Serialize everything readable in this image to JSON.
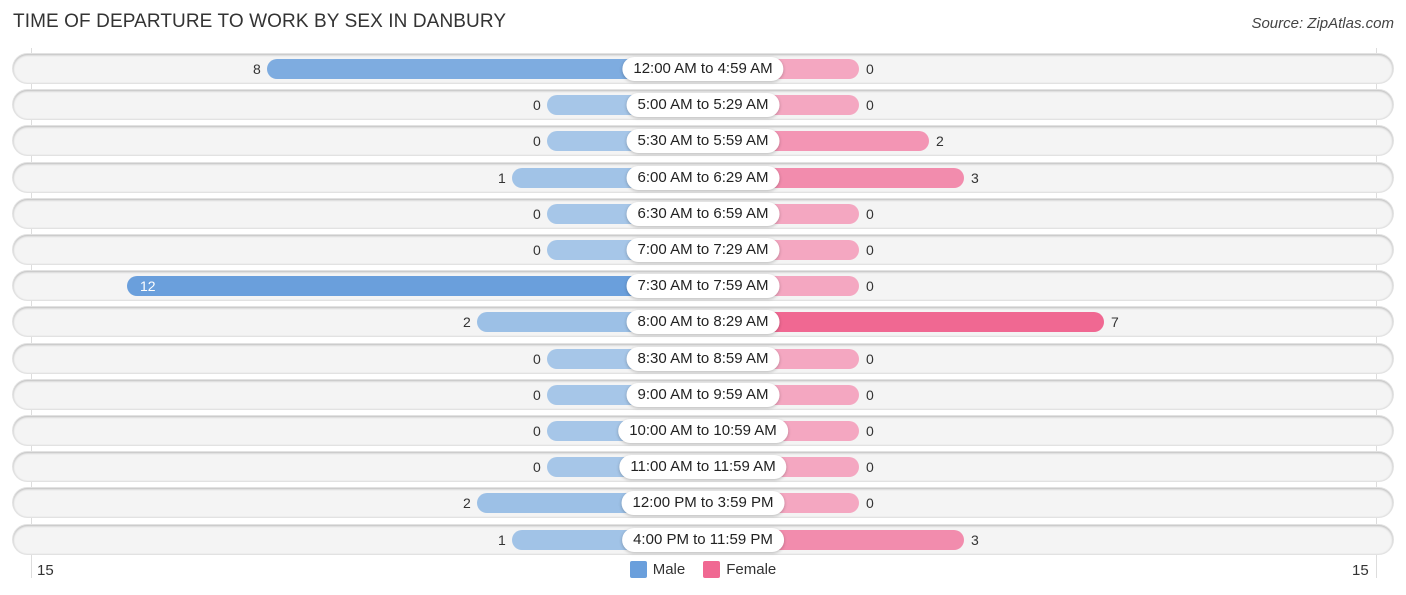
{
  "title": "TIME OF DEPARTURE TO WORK BY SEX IN DANBURY",
  "source": "Source: ZipAtlas.com",
  "colors": {
    "male": "#a6c6e8",
    "male_strong": "#6a9fdc",
    "female": "#f4a7c1",
    "female_strong": "#f06892"
  },
  "chart_data": {
    "type": "bar",
    "orientation": "horizontal-diverging",
    "title": "TIME OF DEPARTURE TO WORK BY SEX IN DANBURY",
    "categories": [
      "12:00 AM to 4:59 AM",
      "5:00 AM to 5:29 AM",
      "5:30 AM to 5:59 AM",
      "6:00 AM to 6:29 AM",
      "6:30 AM to 6:59 AM",
      "7:00 AM to 7:29 AM",
      "7:30 AM to 7:59 AM",
      "8:00 AM to 8:29 AM",
      "8:30 AM to 8:59 AM",
      "9:00 AM to 9:59 AM",
      "10:00 AM to 10:59 AM",
      "11:00 AM to 11:59 AM",
      "12:00 PM to 3:59 PM",
      "4:00 PM to 11:59 PM"
    ],
    "series": [
      {
        "name": "Male",
        "values": [
          8,
          0,
          0,
          1,
          0,
          0,
          12,
          2,
          0,
          0,
          0,
          0,
          2,
          1
        ]
      },
      {
        "name": "Female",
        "values": [
          0,
          0,
          2,
          3,
          0,
          0,
          0,
          7,
          0,
          0,
          0,
          0,
          0,
          3
        ]
      }
    ],
    "xlim": [
      -15,
      15
    ],
    "tick_labels": {
      "left": "15",
      "right": "15"
    },
    "legend": {
      "placement": "bottom-center",
      "entries": [
        "Male",
        "Female"
      ]
    },
    "grid": false
  }
}
